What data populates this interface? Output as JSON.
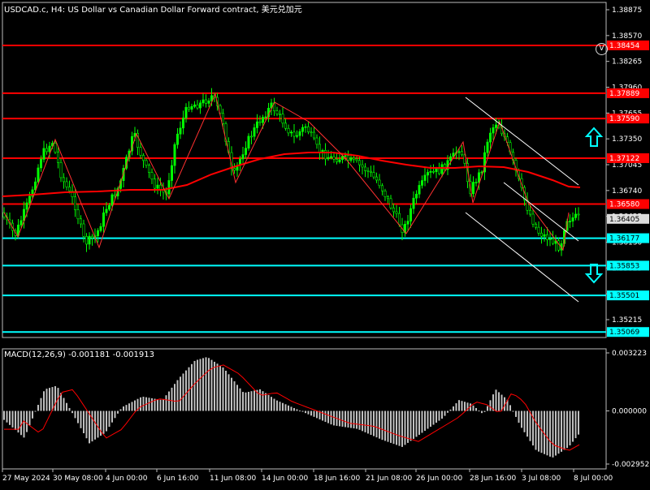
{
  "header": {
    "title": "USDCAD.c, H4:  US Dollar vs Canadian Dollar Forward contract, 美元兑加元"
  },
  "price_axis": {
    "ticks": [
      "1.38875",
      "1.38570",
      "1.38265",
      "1.37960",
      "1.37655",
      "1.37350",
      "1.37045",
      "1.36740",
      "1.36435",
      "1.36130",
      "1.35825",
      "1.35520",
      "1.35215"
    ]
  },
  "current_price": "1.36405",
  "levels": {
    "resistance": [
      "1.38454",
      "1.37889",
      "1.37590",
      "1.37122",
      "1.36580"
    ],
    "support": [
      "1.36177",
      "1.35853",
      "1.35501",
      "1.35069"
    ]
  },
  "macd": {
    "label": "MACD(12,26,9) -0.001181 -0.001913",
    "ticks": [
      "0.003223",
      "0.000000",
      "-0.002952"
    ]
  },
  "time_axis": [
    "27 May 2024",
    "30 May 08:00",
    "4 Jun 00:00",
    "6 Jun 16:00",
    "11 Jun 08:00",
    "14 Jun 00:00",
    "18 Jun 16:00",
    "21 Jun 08:00",
    "26 Jun 00:00",
    "28 Jun 16:00",
    "3 Jul 08:00",
    "8 Jul 00:00"
  ],
  "icons": {
    "up": "up-arrow-icon",
    "down": "down-arrow-icon",
    "logo": "broker-logo-icon",
    "logo_text": "V"
  },
  "colors": {
    "background": "#000000",
    "candle": "#00ff00",
    "moving_average": "#ff0000",
    "resistance": "#ff0000",
    "support": "#00ffff",
    "macd_hist": "#c0c0c0",
    "macd_signal": "#ff0000",
    "grid": "#444444"
  }
}
